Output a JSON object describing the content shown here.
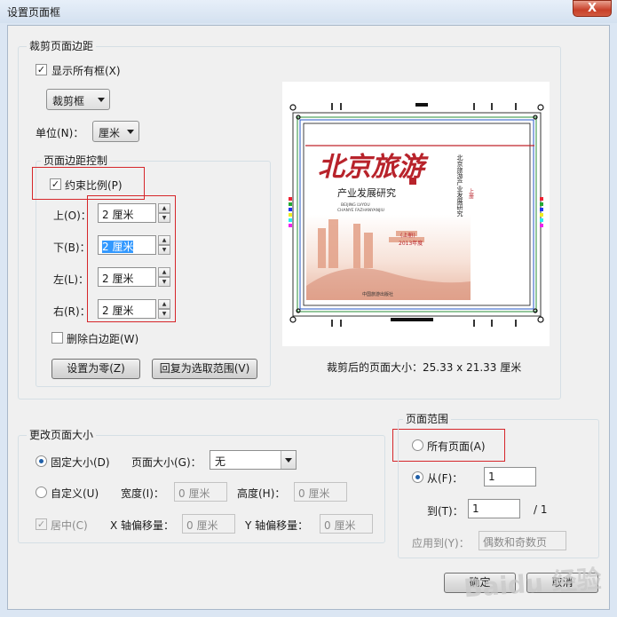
{
  "window": {
    "title": "设置页面框",
    "close_label": "X"
  },
  "crop_margins": {
    "group_title": "裁剪页面边距",
    "show_all_boxes": {
      "label": "显示所有框(X)",
      "checked": true
    },
    "box_type": "裁剪框",
    "unit_label": "单位(N)：",
    "unit_value": "厘米",
    "margin_controls": {
      "group_title": "页面边距控制",
      "constrain": {
        "label": "约束比例(P)",
        "checked": true
      },
      "top": {
        "label": "上(O)：",
        "value": "2 厘米"
      },
      "bottom": {
        "label": "下(B)：",
        "value": "2 厘米"
      },
      "left": {
        "label": "左(L)：",
        "value": "2 厘米"
      },
      "right": {
        "label": "右(R)：",
        "value": "2 厘米"
      },
      "remove_white": {
        "label": "删除白边距(W)",
        "checked": false
      },
      "set_zero": "设置为零(Z)",
      "revert": "回复为选取范围(V)"
    },
    "preview": {
      "cover_title": "北京旅游",
      "cover_subtitle": "产业发展研究",
      "cover_pinyin_1": "BEIJING LVYOU",
      "cover_pinyin_2": "CHANYE FAZHANYANJIU",
      "cover_volume": "(上册)",
      "cover_year": "2013年度",
      "cover_publisher": "中国旅游出版社",
      "spine_title": "北京旅游产业发展研究",
      "spine_volume": "上册"
    },
    "cropped_size": "裁剪后的页面大小：25.33 x 21.33 厘米"
  },
  "page_size": {
    "group_title": "更改页面大小",
    "fixed_size": {
      "label": "固定大小(D)",
      "selected": true
    },
    "page_size_label": "页面大小(G)：",
    "page_size_value": "无",
    "custom": {
      "label": "自定义(U)",
      "selected": false
    },
    "width_label": "宽度(I)：",
    "width_value": "0 厘米",
    "height_label": "高度(H)：",
    "height_value": "0 厘米",
    "center": {
      "label": "居中(C)",
      "checked": true
    },
    "x_offset_label": "X 轴偏移量：",
    "x_offset_value": "0 厘米",
    "y_offset_label": "Y 轴偏移量：",
    "y_offset_value": "0 厘米"
  },
  "page_range": {
    "group_title": "页面范围",
    "all_pages": {
      "label": "所有页面(A)",
      "selected": false
    },
    "from": {
      "label": "从(F)：",
      "value": "1",
      "selected": true
    },
    "to_label": "到(T)：",
    "to_value": "1",
    "total": "/ 1",
    "apply_to_label": "应用到(Y)：",
    "apply_to_value": "偶数和奇数页"
  },
  "buttons": {
    "ok": "确定",
    "cancel": "取消"
  },
  "watermark": "Baidu 经验",
  "colors": {
    "highlight_red": "#d6262a",
    "selection_blue": "#3399ff"
  }
}
